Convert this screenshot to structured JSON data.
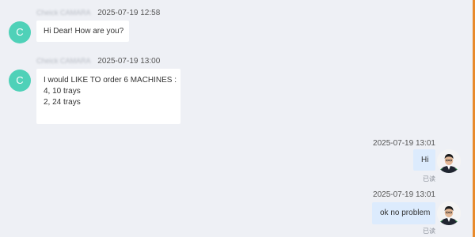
{
  "messages": [
    {
      "direction": "incoming",
      "avatar_letter": "C",
      "sender": "Cheick CAMARA",
      "timestamp": "2025-07-19 12:58",
      "lines": [
        "Hi Dear! How are you?"
      ]
    },
    {
      "direction": "incoming",
      "avatar_letter": "C",
      "sender": "Cheick CAMARA",
      "timestamp": "2025-07-19 13:00",
      "lines": [
        "I would LIKE TO order 6 MACHINES :",
        "4, 10 trays",
        "2, 24 trays"
      ]
    },
    {
      "direction": "outgoing",
      "timestamp": "2025-07-19 13:01",
      "text": "Hi",
      "status": "已读"
    },
    {
      "direction": "outgoing",
      "timestamp": "2025-07-19 13:01",
      "text": "ok no problem",
      "status": "已读"
    }
  ],
  "colors": {
    "background": "#eef0f5",
    "incoming_bubble": "#ffffff",
    "outgoing_bubble": "#dcebfd",
    "avatar_letter_bg": "#4fd1b8",
    "edge_accent": "#e98a2b"
  },
  "icons": {
    "contact_avatar": "letter-avatar",
    "own_avatar": "user-photo-avatar"
  }
}
